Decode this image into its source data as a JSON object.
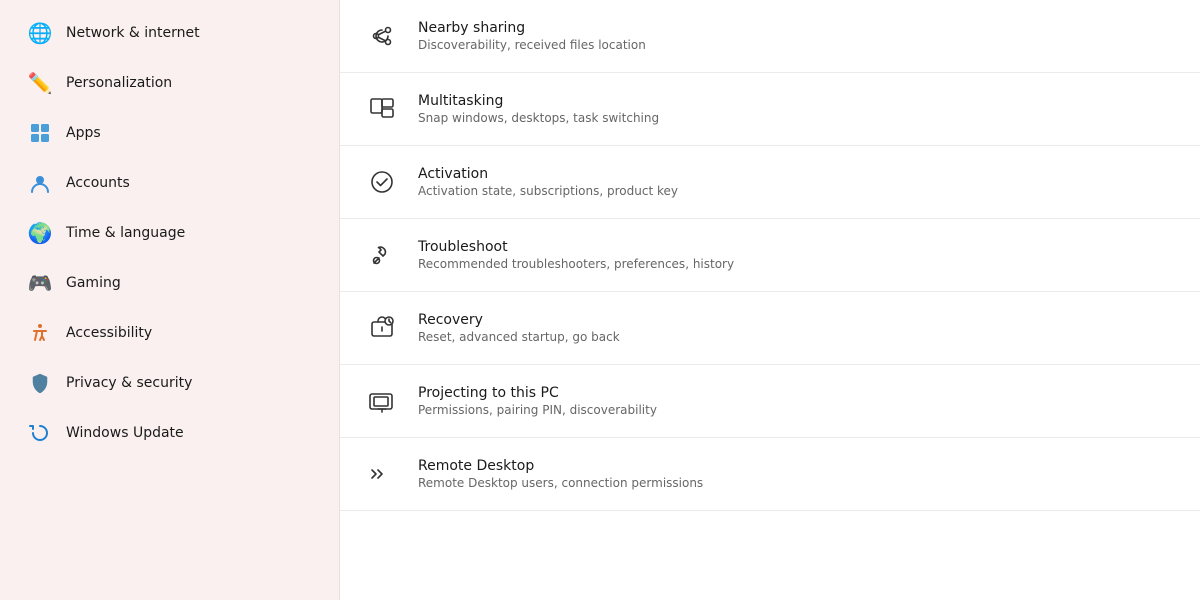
{
  "sidebar": {
    "items": [
      {
        "id": "network",
        "label": "Network & internet",
        "icon": "🌐"
      },
      {
        "id": "personalization",
        "label": "Personalization",
        "icon": "✏️"
      },
      {
        "id": "apps",
        "label": "Apps",
        "icon": "🟦"
      },
      {
        "id": "accounts",
        "label": "Accounts",
        "icon": "🧑"
      },
      {
        "id": "time",
        "label": "Time & language",
        "icon": "🌍"
      },
      {
        "id": "gaming",
        "label": "Gaming",
        "icon": "🎮"
      },
      {
        "id": "accessibility",
        "label": "Accessibility",
        "icon": "♿"
      },
      {
        "id": "privacy",
        "label": "Privacy & security",
        "icon": "🛡️"
      },
      {
        "id": "update",
        "label": "Windows Update",
        "icon": "🔄"
      }
    ]
  },
  "settings": [
    {
      "id": "nearby-sharing",
      "title": "Nearby sharing",
      "desc": "Discoverability, received files location",
      "icon": "share"
    },
    {
      "id": "multitasking",
      "title": "Multitasking",
      "desc": "Snap windows, desktops, task switching",
      "icon": "multitasking"
    },
    {
      "id": "activation",
      "title": "Activation",
      "desc": "Activation state, subscriptions, product key",
      "icon": "activation"
    },
    {
      "id": "troubleshoot",
      "title": "Troubleshoot",
      "desc": "Recommended troubleshooters, preferences, history",
      "icon": "wrench"
    },
    {
      "id": "recovery",
      "title": "Recovery",
      "desc": "Reset, advanced startup, go back",
      "icon": "recovery"
    },
    {
      "id": "projecting",
      "title": "Projecting to this PC",
      "desc": "Permissions, pairing PIN, discoverability",
      "icon": "projecting"
    },
    {
      "id": "remote-desktop",
      "title": "Remote Desktop",
      "desc": "Remote Desktop users, connection permissions",
      "icon": "remote"
    }
  ]
}
